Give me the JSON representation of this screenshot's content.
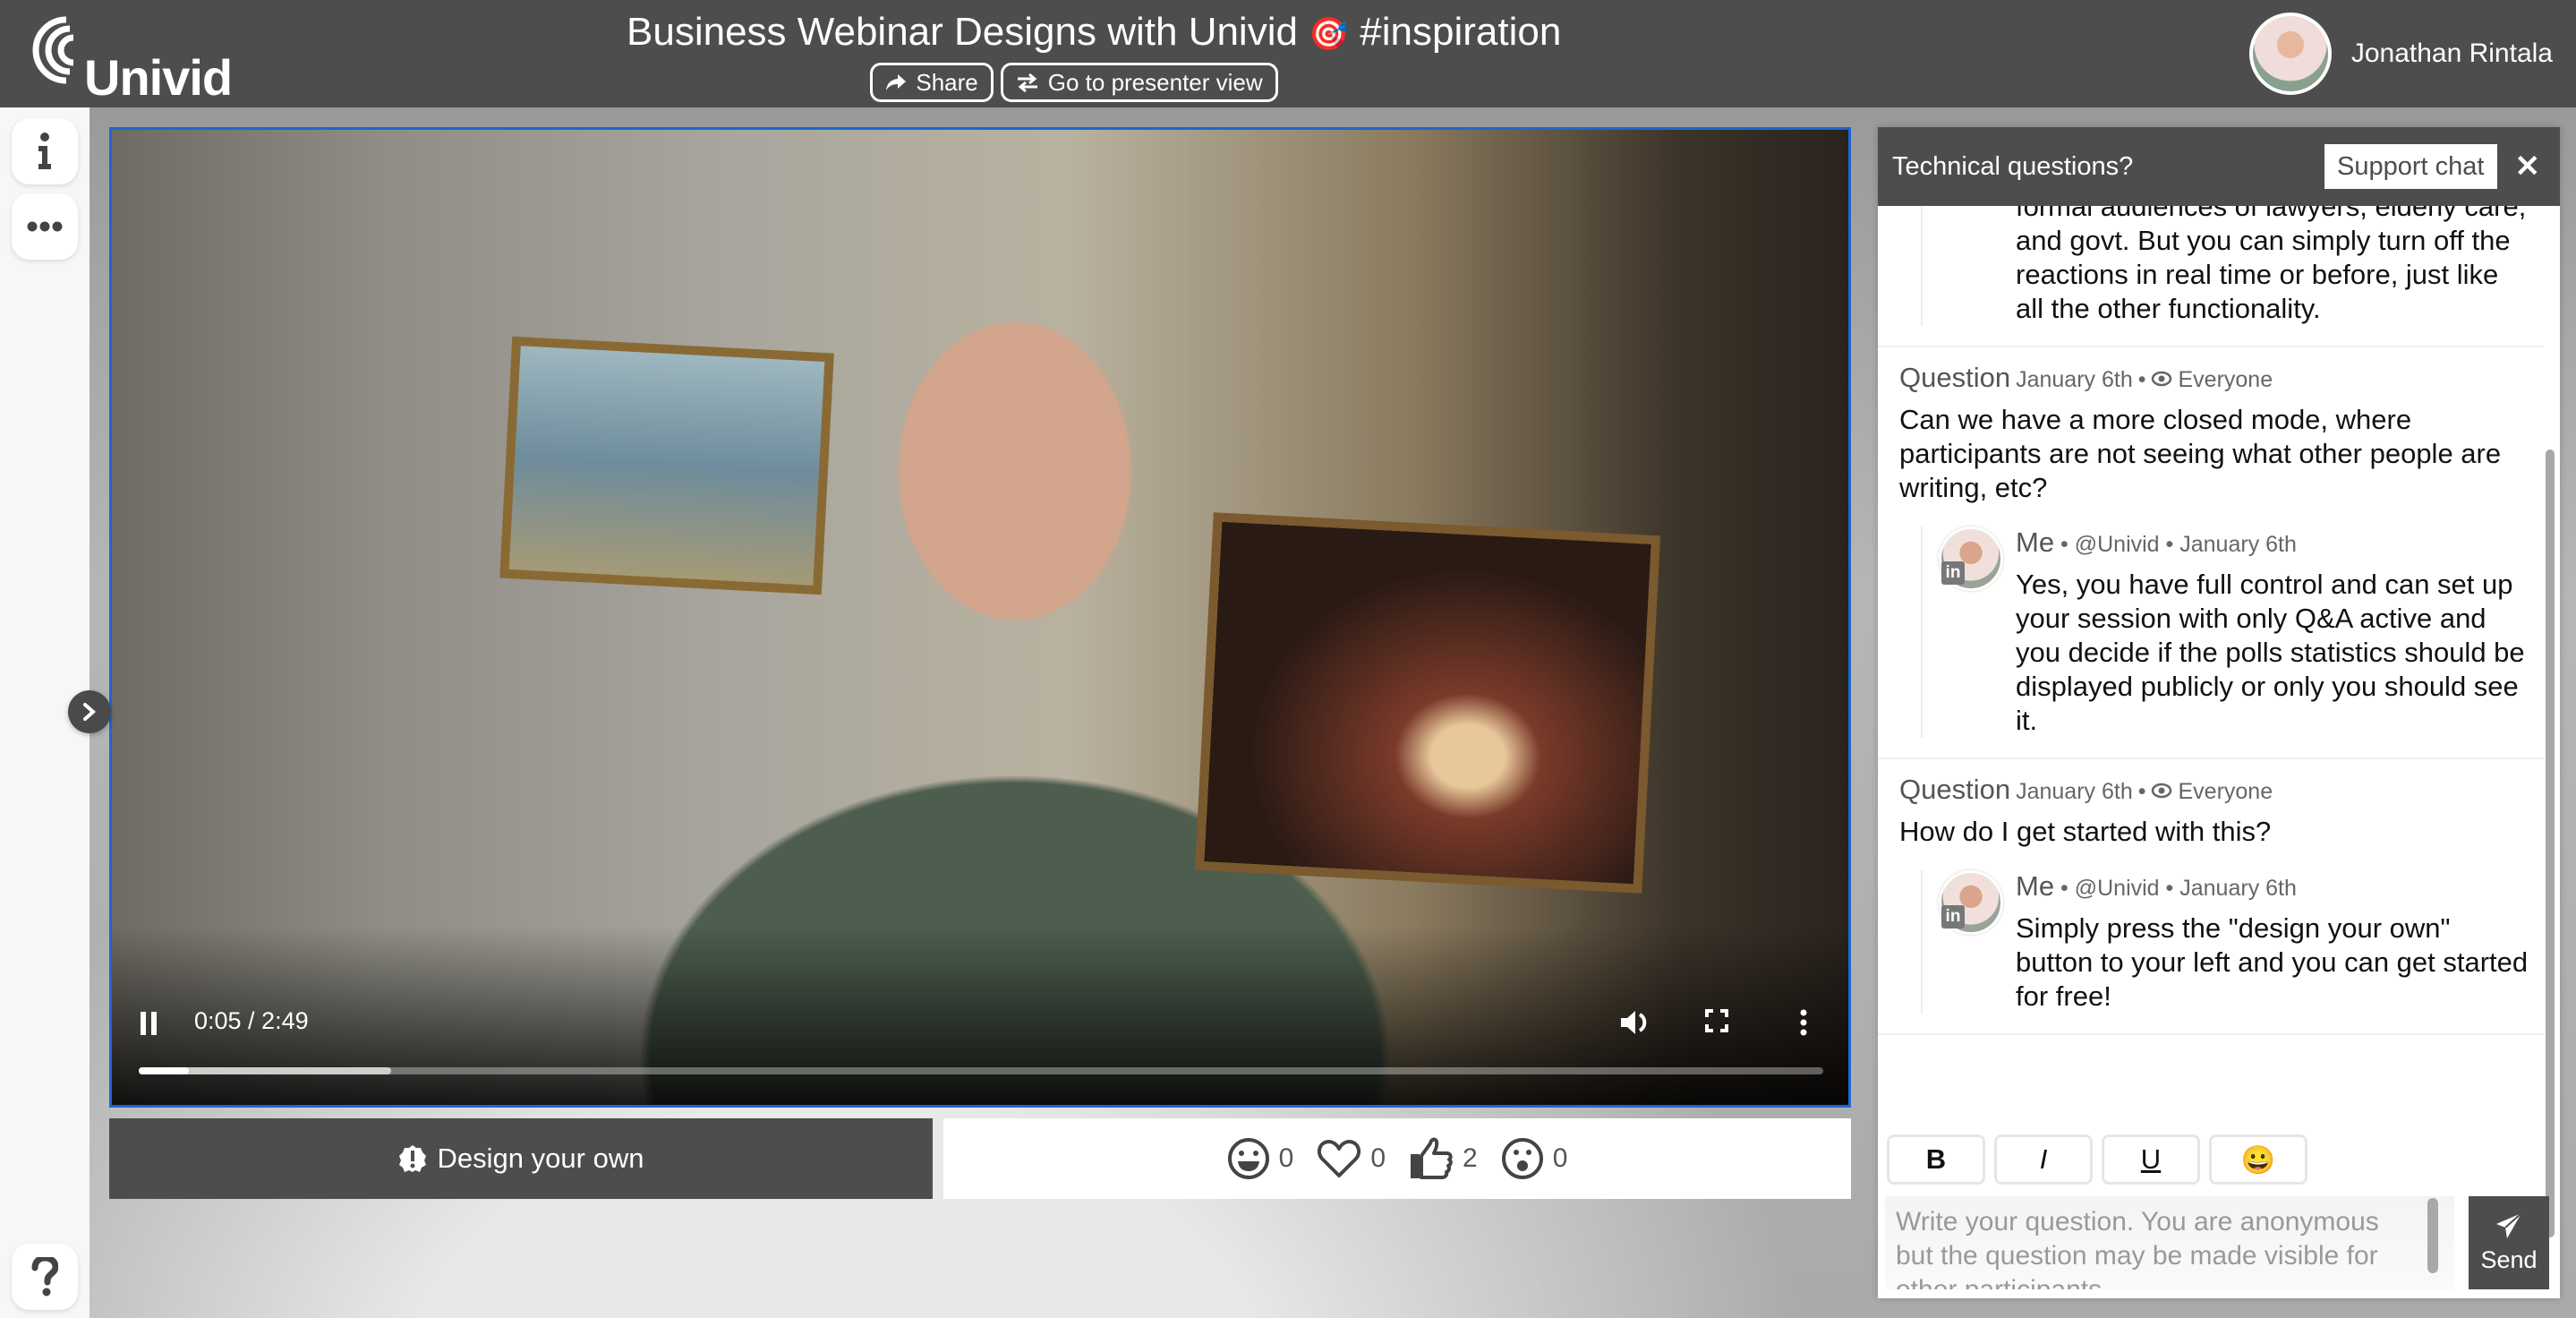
{
  "header": {
    "logo_text": "Univid",
    "title": "Business Webinar Designs with Univid",
    "title_emoji": "🎯",
    "title_hashtag": "#inspiration",
    "share_label": "Share",
    "presenter_view_label": "Go to presenter view",
    "user_name": "Jonathan Rintala"
  },
  "sidebar": {
    "info_icon": "info-icon",
    "more_icon": "more-horizontal-icon",
    "help_icon": "question-icon",
    "expand_icon": "chevron-right-icon"
  },
  "video": {
    "time_display": "0:05 / 2:49",
    "current_time": "0:05",
    "duration": "2:49",
    "played_fraction": 0.03,
    "buffered_fraction": 0.15,
    "state": "playing"
  },
  "design_button": {
    "label": "Design your own",
    "icon": "exclamation-badge-icon"
  },
  "reactions": [
    {
      "name": "laugh",
      "icon": "laughing-face-icon",
      "count": "0"
    },
    {
      "name": "heart",
      "icon": "heart-icon",
      "count": "0"
    },
    {
      "name": "thumbs-up",
      "icon": "thumbs-up-icon",
      "count": "2"
    },
    {
      "name": "wow",
      "icon": "surprised-face-icon",
      "count": "0"
    }
  ],
  "chat": {
    "header_title": "Technical questions?",
    "support_label": "Support chat",
    "close_label": "✕",
    "entries": [
      {
        "clipped_reply": "formal audiences of lawyers, elderly care, and govt. But you can simply turn off the reactions in real time or before, just like all the other functionality."
      },
      {
        "label": "Question",
        "date": "January 6th",
        "separator": "•",
        "visibility": "Everyone",
        "text": "Can we have a more closed mode, where participants are not seeing what other people are writing, etc?",
        "reply": {
          "name": "Me",
          "handle": "@Univid",
          "date": "January 6th",
          "text": "Yes, you have full control and can set up your session with only Q&A active and you decide if the polls statistics should be displayed publicly or only you should see it."
        }
      },
      {
        "label": "Question",
        "date": "January 6th",
        "separator": "•",
        "visibility": "Everyone",
        "text": "How do I get started with this?",
        "reply": {
          "name": "Me",
          "handle": "@Univid",
          "date": "January 6th",
          "text": "Simply press the \"design your own\" button to your left and you can get started for free!"
        }
      }
    ],
    "format_buttons": {
      "bold": "B",
      "italic": "I",
      "underline": "U",
      "emoji": "😀"
    },
    "compose_placeholder": "Write your question. You are anonymous but the question may be made visible for other participants",
    "send_label": "Send"
  }
}
